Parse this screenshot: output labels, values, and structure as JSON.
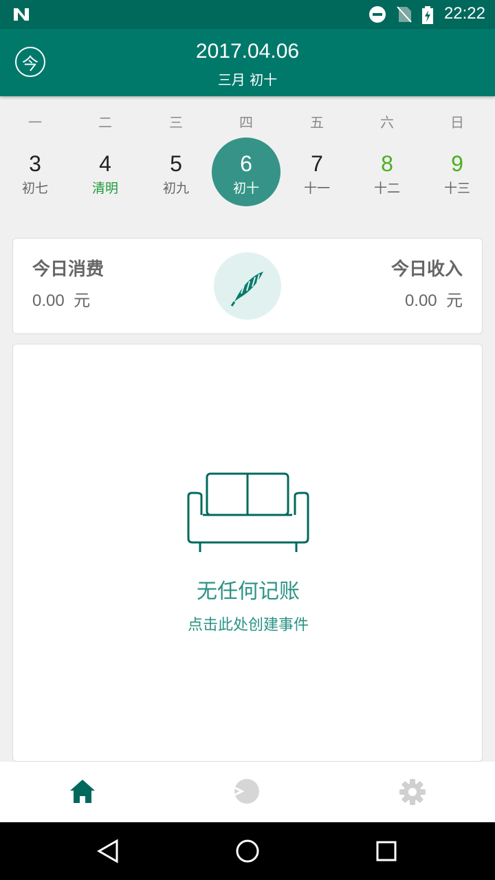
{
  "status_bar": {
    "time": "22:22",
    "icons": [
      "n-logo-icon",
      "dnd-icon",
      "no-sim-icon",
      "battery-charging-icon"
    ]
  },
  "app_bar": {
    "today_label": "今",
    "date": "2017.04.06",
    "lunar": "三月 初十"
  },
  "week": {
    "weekdays": [
      "一",
      "二",
      "三",
      "四",
      "五",
      "六",
      "日"
    ],
    "days": [
      {
        "num": "3",
        "lunar": "初七"
      },
      {
        "num": "4",
        "lunar": "清明"
      },
      {
        "num": "5",
        "lunar": "初九"
      },
      {
        "num": "6",
        "lunar": "初十"
      },
      {
        "num": "7",
        "lunar": "十一"
      },
      {
        "num": "8",
        "lunar": "十二"
      },
      {
        "num": "9",
        "lunar": "十三"
      }
    ]
  },
  "summary": {
    "expense_label": "今日消费",
    "expense_value": "0.00",
    "expense_unit": "元",
    "income_label": "今日收入",
    "income_value": "0.00",
    "income_unit": "元"
  },
  "empty": {
    "title": "无任何记账",
    "subtitle": "点击此处创建事件"
  },
  "bottom_nav": [
    "home-icon",
    "chart-icon",
    "settings-icon"
  ],
  "colors": {
    "primary": "#00796b",
    "primary_dark": "#00695c",
    "accent": "#359487",
    "weekend": "#4caf1e"
  }
}
